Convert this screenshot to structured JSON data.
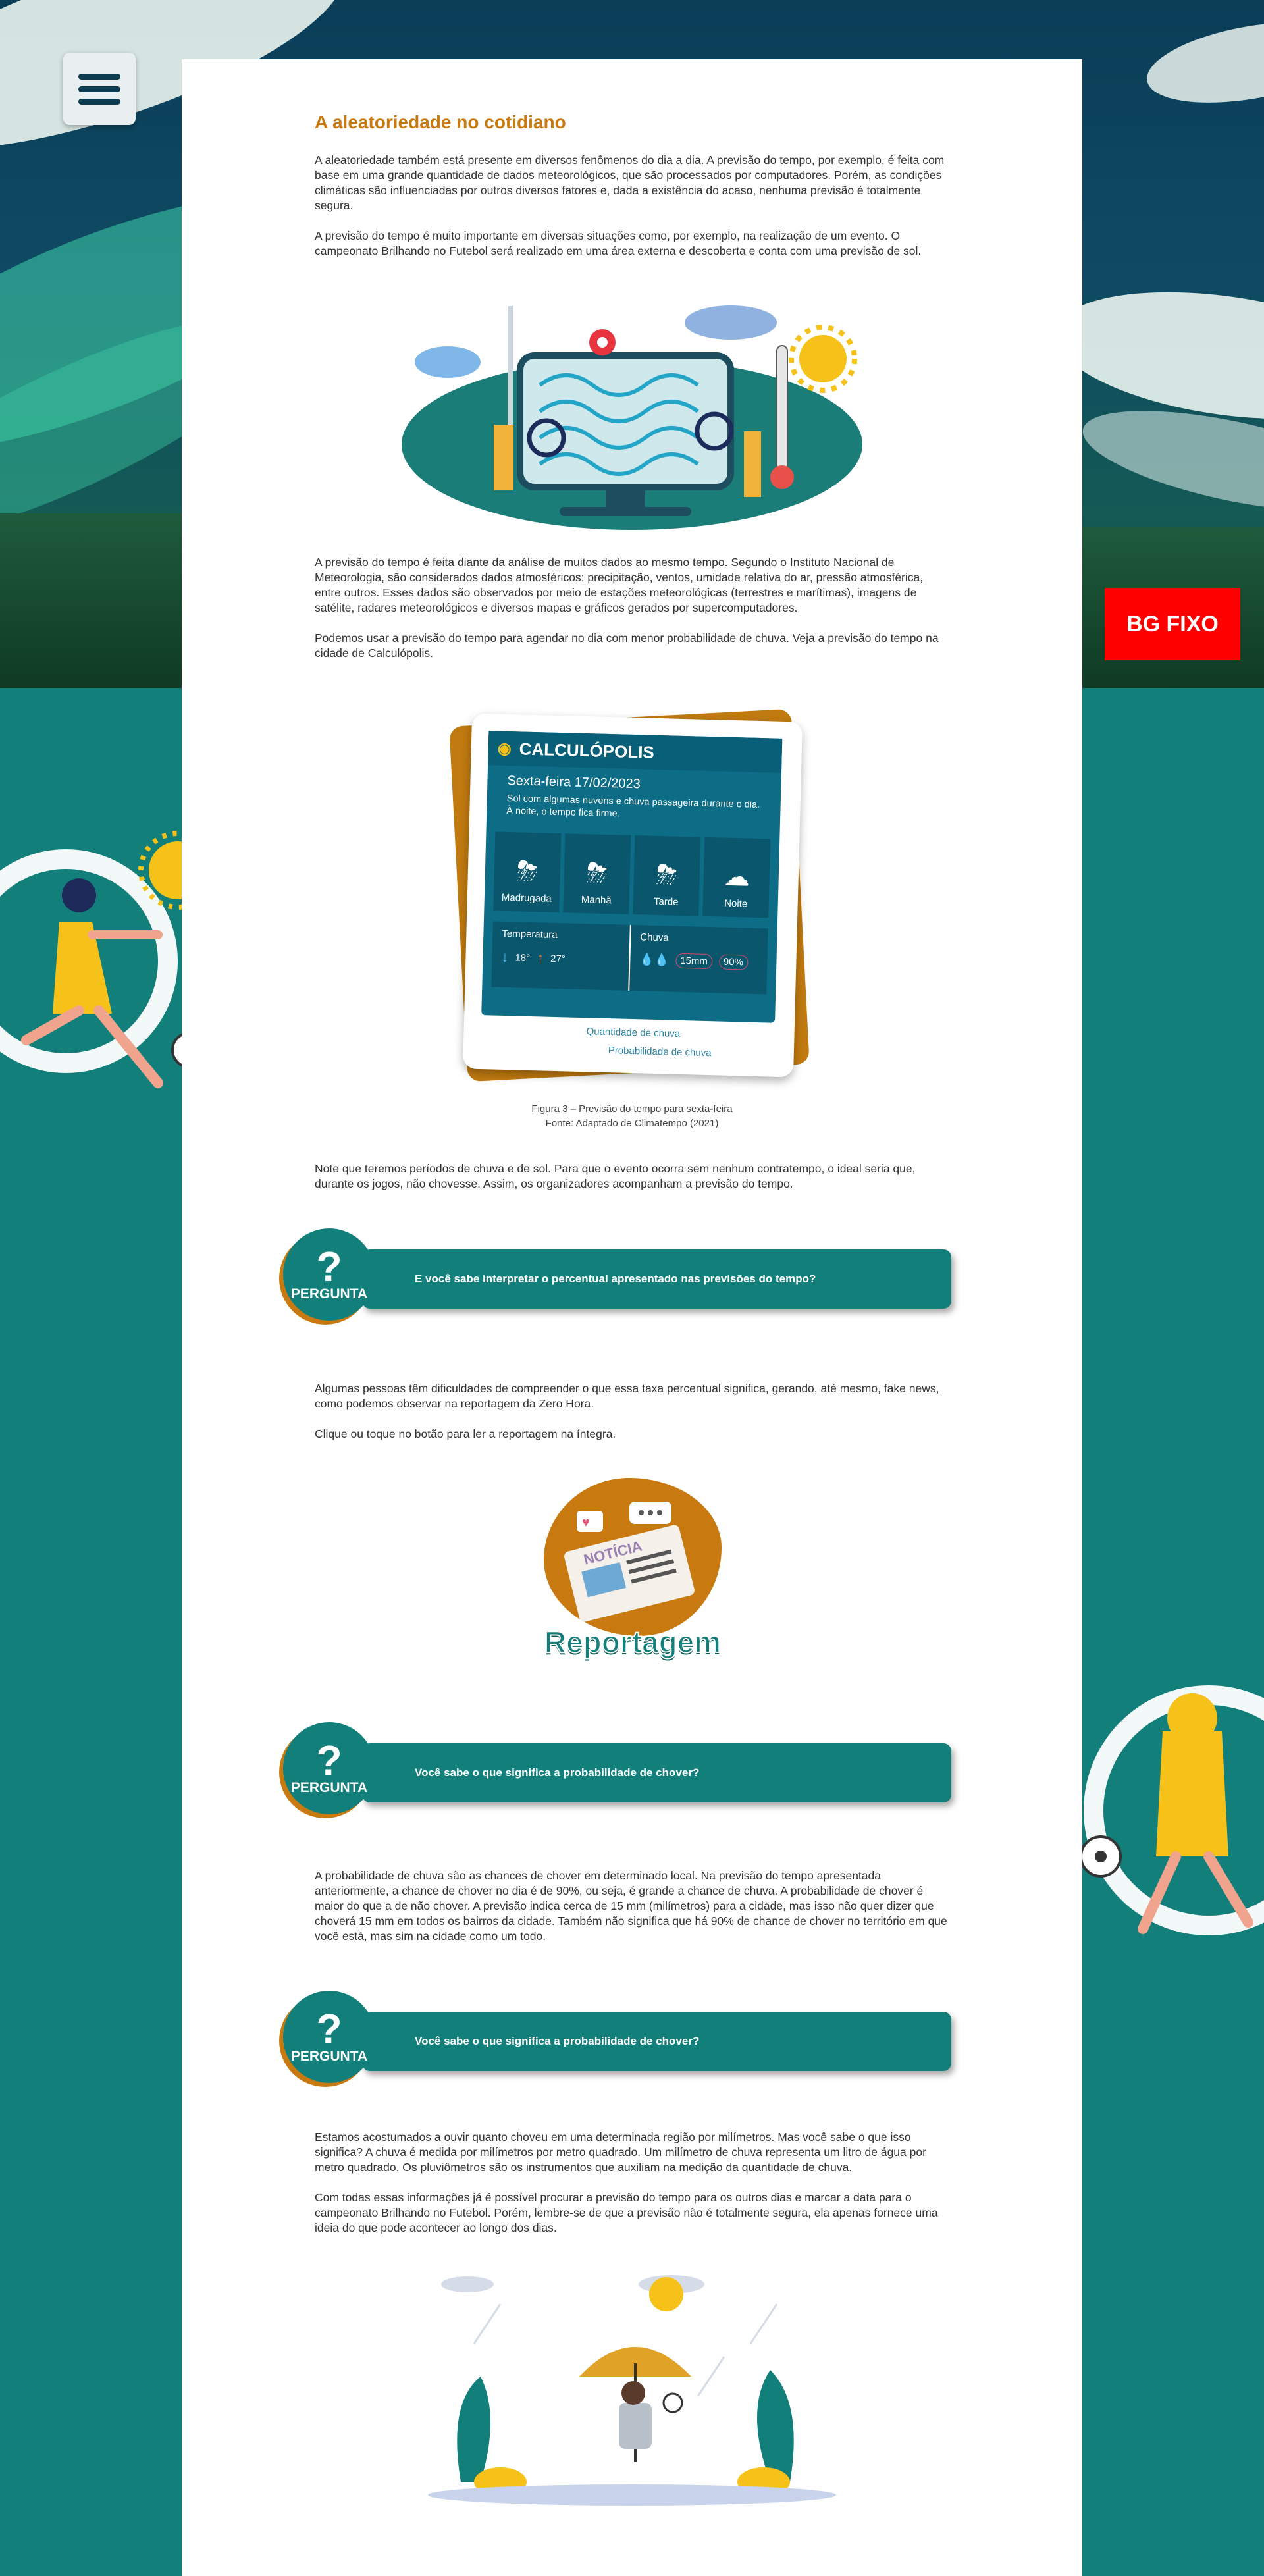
{
  "menu": {
    "icon": "hamburger-menu-icon"
  },
  "badge": {
    "label": "BG FIXO"
  },
  "section": {
    "title": "A aleatoriedade no cotidiano",
    "p1": "A aleatoriedade também está presente em diversos fenômenos do dia a dia. A previsão do tempo, por exemplo, é feita com base em uma grande quantidade de dados meteorológicos, que são processados por computadores. Porém, as condições climáticas são influenciadas por outros diversos fatores e, dada a existência do acaso, nenhuma previsão é totalmente segura.",
    "p2": "A previsão do tempo é muito importante em diversas situações como, por exemplo, na realização de um evento. O campeonato Brilhando no Futebol será realizado em uma área externa e descoberta e conta com uma previsão de sol.",
    "p3": "A previsão do tempo é feita diante da análise de muitos dados ao mesmo tempo. Segundo o Instituto Nacional de Meteorologia, são considerados dados atmosféricos: precipitação, ventos, umidade relativa do ar, pressão atmosférica, entre outros. Esses dados são observados por meio de estações meteorológicas (terrestres e marítimas), imagens de satélite, radares meteorológicos e diversos mapas e gráficos gerados por supercomputadores.",
    "p4": "Podemos usar a previsão do tempo para agendar no dia com menor probabilidade de chuva. Veja a previsão do tempo na cidade de Calculópolis.",
    "p5": "Note que teremos períodos de chuva e de sol. Para que o evento ocorra sem nenhum contratempo, o ideal seria que, durante os jogos, não chovesse. Assim, os organizadores acompanham a previsão do tempo.",
    "p6": "Algumas pessoas têm dificuldades de compreender o que essa taxa percentual significa, gerando, até mesmo, fake news, como podemos observar na reportagem da Zero Hora.",
    "p7": "Clique ou toque no botão para ler a reportagem na íntegra.",
    "p8": "A probabilidade de chuva são as chances de chover em determinado local. Na previsão do tempo apresentada anteriormente, a chance de chover no dia é de 90%, ou seja, é grande a chance de chuva. A probabilidade de chover é maior do que a de não chover. A previsão indica cerca de 15 mm (milímetros) para a cidade, mas isso não quer dizer que choverá 15 mm em todos os bairros da cidade. Também não significa que há 90% de chance de chover no território em que você está, mas sim na cidade como um todo.",
    "p9": "Estamos acostumados a ouvir quanto choveu em uma determinada região por milímetros. Mas você sabe o que isso significa? A chuva é medida por milímetros por metro quadrado. Um milímetro de chuva representa um litro de água por metro quadrado. Os pluviômetros são os instrumentos que auxiliam na medição da quantidade de chuva.",
    "p10": "Com todas essas informações já é possível procurar a previsão do tempo para os outros dias e marcar a data para o campeonato Brilhando no Futebol. Porém, lembre-se de que a previsão não é totalmente segura, ela apenas fornece uma ideia do que pode acontecer ao longo dos dias."
  },
  "weather": {
    "city": "CALCULÓPOLIS",
    "date": "Sexta-feira  17/02/2023",
    "description": "Sol com algumas nuvens e chuva passageira durante o dia. À noite, o tempo fica firme.",
    "periods": [
      {
        "label": "Madrugada",
        "icon": "cloud-lightning-rain-icon"
      },
      {
        "label": "Manhã",
        "icon": "cloud-lightning-rain-icon"
      },
      {
        "label": "Tarde",
        "icon": "cloud-lightning-rain-icon"
      },
      {
        "label": "Noite",
        "icon": "moon-cloud-icon"
      }
    ],
    "temp_label": "Temperatura",
    "temp_min": "18°",
    "temp_max": "27°",
    "rain_label": "Chuva",
    "rain_amount": "15mm",
    "rain_prob": "90%",
    "annot_amount": "Quantidade de chuva",
    "annot_prob": "Probabilidade de chuva"
  },
  "figure": {
    "caption": "Figura 3 – Previsão do tempo para sexta-feira",
    "source": "Fonte: Adaptado de Climatempo (2021)"
  },
  "questions": [
    {
      "badge_mark": "?",
      "badge_word": "PERGUNTA",
      "text": "E você sabe interpretar o percentual apresentado nas previsões do tempo?"
    },
    {
      "badge_mark": "?",
      "badge_word": "PERGUNTA",
      "text": "Você sabe o que significa a probabilidade de chover?"
    },
    {
      "badge_mark": "?",
      "badge_word": "PERGUNTA",
      "text": "Você sabe o que significa a probabilidade de chover?"
    }
  ],
  "report": {
    "news_tag": "NOTÍCIA",
    "label": "Reportagem"
  },
  "colors": {
    "teal": "#137f7a",
    "orange": "#c87a10",
    "navy": "#0b3d57",
    "red": "#ff0000"
  }
}
